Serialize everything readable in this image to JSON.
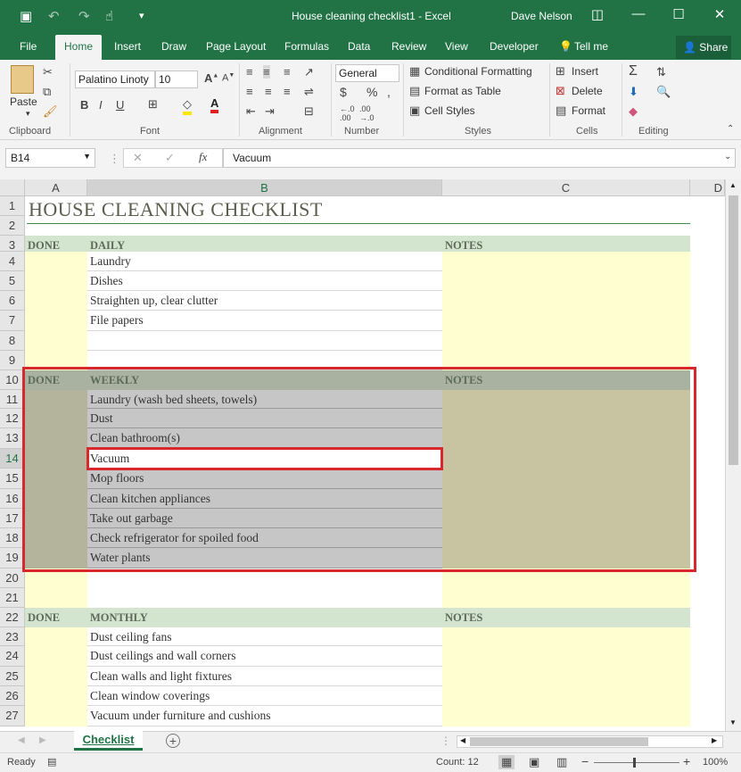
{
  "window": {
    "title": "House cleaning checklist1 - Excel",
    "user": "Dave Nelson"
  },
  "tabs": [
    "File",
    "Home",
    "Insert",
    "Draw",
    "Page Layout",
    "Formulas",
    "Data",
    "Review",
    "View",
    "Developer",
    "Tell me"
  ],
  "share": "Share",
  "ribbon": {
    "clipboard": {
      "paste": "Paste",
      "group": "Clipboard"
    },
    "font": {
      "family": "Palatino Linoty",
      "size": "10",
      "group": "Font"
    },
    "alignment": {
      "group": "Alignment"
    },
    "number": {
      "format": "General",
      "group": "Number"
    },
    "styles": {
      "conditional": "Conditional Formatting",
      "table": "Format as Table",
      "cell": "Cell Styles",
      "group": "Styles"
    },
    "cells": {
      "insert": "Insert",
      "delete": "Delete",
      "format": "Format",
      "group": "Cells"
    },
    "editing": {
      "group": "Editing"
    }
  },
  "formula": {
    "namebox": "B14",
    "content": "Vacuum"
  },
  "columns": [
    "A",
    "B",
    "C",
    "D"
  ],
  "sheet": {
    "title": "HOUSE CLEANING CHECKLIST",
    "done": "DONE",
    "notes": "NOTES",
    "daily": {
      "header": "DAILY",
      "items": [
        "Laundry",
        "Dishes",
        "Straighten up, clear clutter",
        "File papers"
      ]
    },
    "weekly": {
      "header": "WEEKLY",
      "items": [
        "Laundry (wash bed sheets, towels)",
        "Dust",
        "Clean bathroom(s)",
        "Vacuum",
        "Mop floors",
        "Clean kitchen appliances",
        "Take out garbage",
        "Check refrigerator for spoiled food",
        "Water plants"
      ]
    },
    "monthly": {
      "header": "MONTHLY",
      "items": [
        "Dust ceiling fans",
        "Dust ceilings and wall corners",
        "Clean walls and light fixtures",
        "Clean window coverings",
        "Vacuum under furniture and cushions"
      ]
    }
  },
  "sheet_tab": "Checklist",
  "status": {
    "ready": "Ready",
    "count": "Count: 12",
    "zoom": "100%"
  },
  "colors": {
    "green": "#217346",
    "header_band": "#d3e4cf",
    "weekly_band": "#a9b2a0",
    "yellow": "#fffed1",
    "notes_weekly": "#c8c3a0",
    "highlight": "#d9272e"
  }
}
